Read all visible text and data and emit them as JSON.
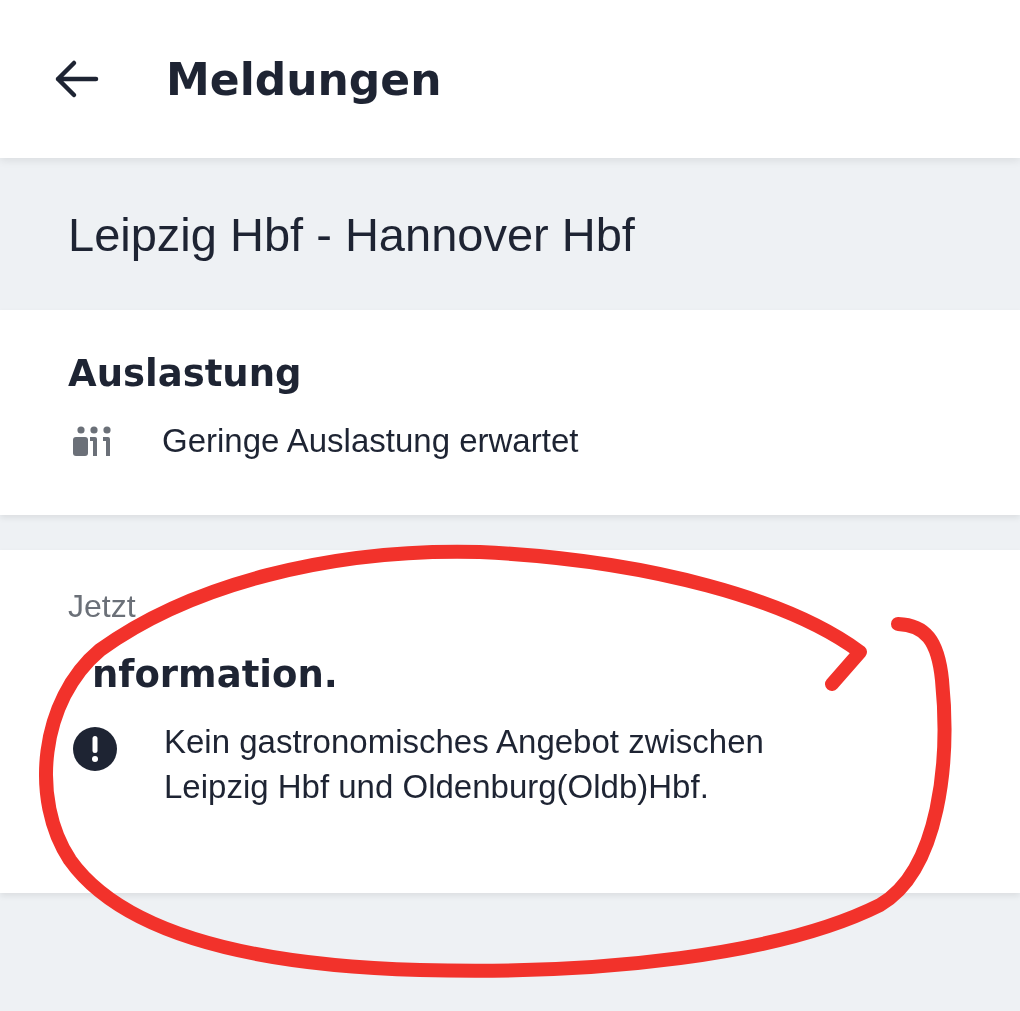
{
  "header": {
    "title": "Meldungen"
  },
  "route": "Leipzig Hbf - Hannover Hbf",
  "occupancy": {
    "heading": "Auslastung",
    "text": "Geringe Auslastung erwartet"
  },
  "message": {
    "time": "Jetzt",
    "heading": "nformation.",
    "text": "Kein gastronomisches Angebot zwischen Leipzig Hbf und Oldenburg(Oldb)Hbf."
  },
  "annotation": {
    "kind": "circle"
  }
}
